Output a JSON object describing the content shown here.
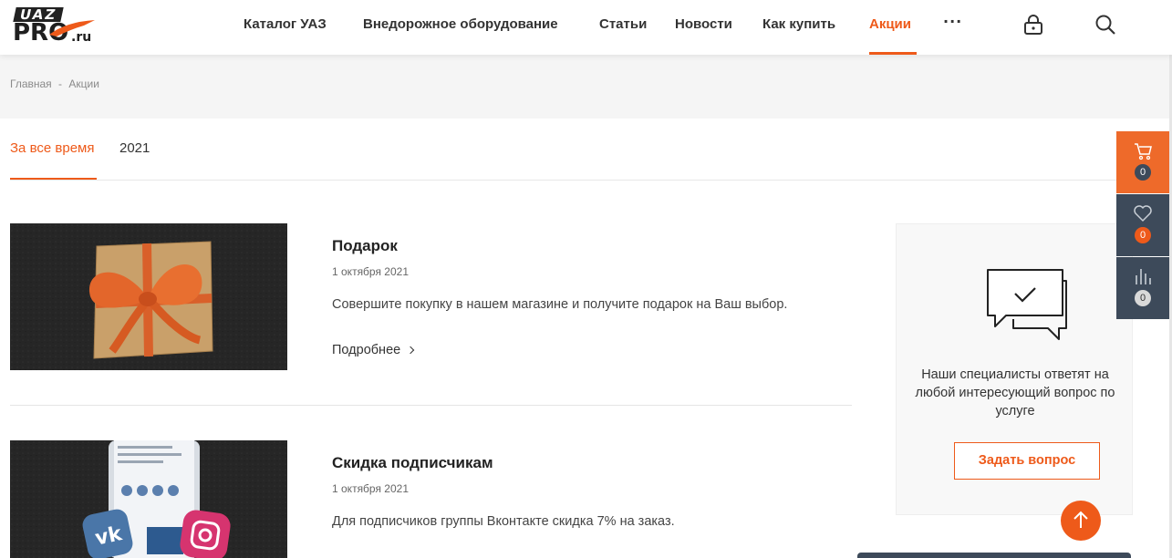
{
  "logo": {
    "top": "UAZ",
    "main": "PRO",
    "suffix": ".ru"
  },
  "nav": {
    "items": [
      {
        "label": "Каталог УАЗ"
      },
      {
        "label": "Внедорожное оборудование"
      },
      {
        "label": "Статьи"
      },
      {
        "label": "Новости"
      },
      {
        "label": "Как купить"
      },
      {
        "label": "Акции",
        "active": true
      }
    ],
    "more": "···"
  },
  "breadcrumb": {
    "home": "Главная",
    "sep": "-",
    "current": "Акции"
  },
  "tabs": [
    {
      "label": "За все время",
      "active": true
    },
    {
      "label": "2021"
    }
  ],
  "items": [
    {
      "title": "Подарок",
      "date": "1 октября 2021",
      "description": "Совершите покупку в нашем магазине и получите подарок на Ваш выбор.",
      "more": "Подробнее"
    },
    {
      "title": "Скидка подписчикам",
      "date": "1 октября 2021",
      "description": "Для подписчиков группы Вконтакте скидка 7% на заказ."
    }
  ],
  "question_box": {
    "text": "Наши специалисты ответят на любой интересующий вопрос по услуге",
    "button": "Задать вопрос"
  },
  "side_panel": {
    "cart_count": "0",
    "favorites_count": "0",
    "compare_count": "0"
  },
  "colors": {
    "accent": "#ee5a1a",
    "panel_dark": "#3d4a5a",
    "band": "#f5f5f5"
  }
}
